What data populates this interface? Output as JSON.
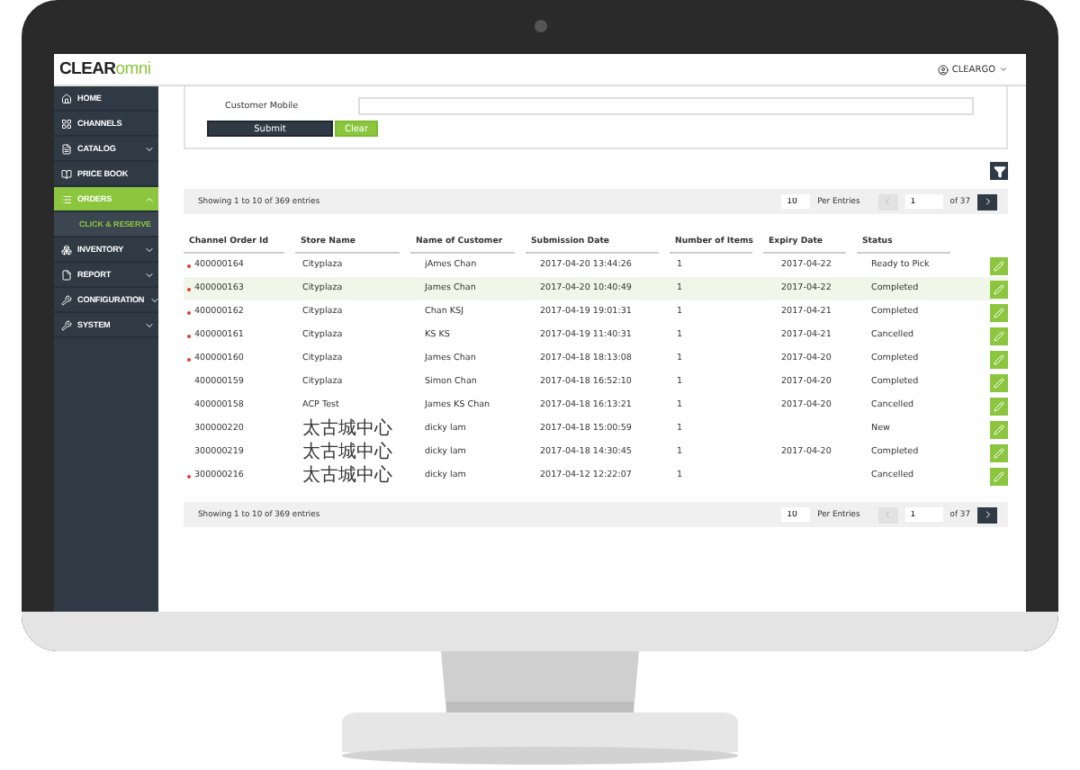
{
  "header": {
    "logo": {
      "brand": "CLEAR",
      "sub": "omni"
    },
    "user": "CLEARGO"
  },
  "sidebar": {
    "items": [
      {
        "label": "HOME",
        "selected": false
      },
      {
        "label": "CHANNELS",
        "selected": false
      },
      {
        "label": "CATALOG",
        "expanded": false,
        "selected": false
      },
      {
        "label": "PRICE BOOK",
        "selected": false
      },
      {
        "label": "ORDERS",
        "expanded": true,
        "selected": true,
        "children": [
          {
            "label": "CLICK & RESERVE",
            "selected": true
          }
        ]
      },
      {
        "label": "INVENTORY",
        "expanded": false,
        "selected": false
      },
      {
        "label": "REPORT",
        "expanded": false,
        "selected": false
      },
      {
        "label": "CONFIGURATION",
        "expanded": false,
        "selected": false
      },
      {
        "label": "SYSTEM",
        "expanded": false,
        "selected": false
      }
    ]
  },
  "form": {
    "field": {
      "label": "Customer Mobile"
    },
    "buttons": [
      {
        "label": "Submit",
        "kind": "primary"
      },
      {
        "label": "Clear",
        "kind": "secondary"
      }
    ]
  },
  "toolbars": [
    {
      "summary": "Showing 1 to 10 of 369 entries",
      "per_page": "10",
      "per_label": "Per Entries",
      "page": "1",
      "of": "of 37",
      "prev_disabled": true
    },
    {
      "summary": "Showing 1 to 10 of 369 entries",
      "per_page": "10",
      "per_label": "Per Entries",
      "page": "1",
      "of": "of 37",
      "prev_disabled": true
    }
  ],
  "table": {
    "columns": [
      "Channel Order Id",
      "Store Name",
      "Name of Customer",
      "Submission Date",
      "Number of Items",
      "Expiry Date",
      "Status"
    ],
    "rows": [
      {
        "flagged": true,
        "selected": false,
        "cells": [
          "400000164",
          "Cityplaza",
          "jAmes Chan",
          "2017-04-20 13:44:26",
          "1",
          "2017-04-22",
          "Ready to Pick"
        ]
      },
      {
        "flagged": true,
        "selected": true,
        "cells": [
          "400000163",
          "Cityplaza",
          "James Chan",
          "2017-04-20 10:40:49",
          "1",
          "2017-04-22",
          "Completed"
        ]
      },
      {
        "flagged": true,
        "selected": false,
        "cells": [
          "400000162",
          "Cityplaza",
          "Chan KSJ",
          "2017-04-19 19:01:31",
          "1",
          "2017-04-21",
          "Completed"
        ]
      },
      {
        "flagged": true,
        "selected": false,
        "cells": [
          "400000161",
          "Cityplaza",
          "KS KS",
          "2017-04-19 11:40:31",
          "1",
          "2017-04-21",
          "Cancelled"
        ]
      },
      {
        "flagged": true,
        "selected": false,
        "cells": [
          "400000160",
          "Cityplaza",
          "James Chan",
          "2017-04-18 18:13:08",
          "1",
          "2017-04-20",
          "Completed"
        ]
      },
      {
        "flagged": false,
        "selected": false,
        "cells": [
          "400000159",
          "Cityplaza",
          "Simon Chan",
          "2017-04-18 16:52:10",
          "1",
          "2017-04-20",
          "Completed"
        ]
      },
      {
        "flagged": false,
        "selected": false,
        "cells": [
          "400000158",
          "ACP Test",
          "James KS Chan",
          "2017-04-18 16:13:21",
          "1",
          "2017-04-20",
          "Cancelled"
        ]
      },
      {
        "flagged": false,
        "selected": false,
        "cells": [
          "300000220",
          "太古城中心",
          "dicky lam",
          "2017-04-18 15:00:59",
          "1",
          null,
          "New"
        ]
      },
      {
        "flagged": false,
        "selected": false,
        "cells": [
          "300000219",
          "太古城中心",
          "dicky lam",
          "2017-04-18 14:30:45",
          "1",
          "2017-04-20",
          "Completed"
        ]
      },
      {
        "flagged": true,
        "selected": false,
        "cells": [
          "300000216",
          "太古城中心",
          "dicky lam",
          "2017-04-12 12:22:07",
          "1",
          null,
          "Cancelled"
        ]
      }
    ]
  }
}
